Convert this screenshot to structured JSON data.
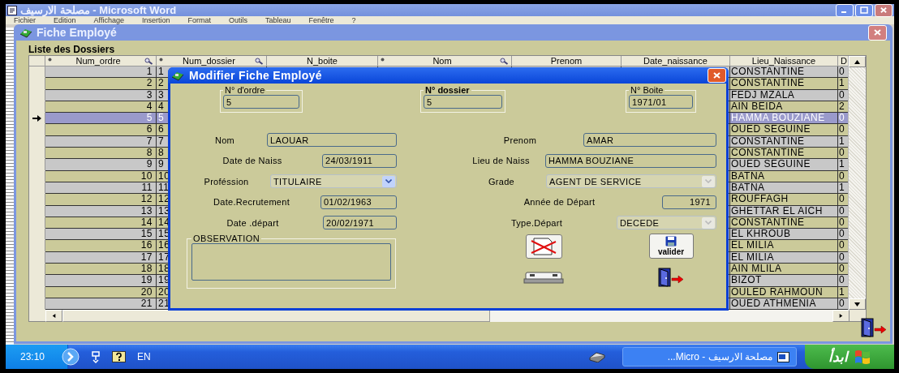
{
  "word_window": {
    "title": "مصلحة الارسيف - Microsoft Word",
    "menu": [
      "Fichier",
      "Edition",
      "Affichage",
      "Insertion",
      "Format",
      "Outils",
      "Tableau",
      "Fenêtre",
      "?"
    ]
  },
  "fiche_window": {
    "title": "Fiche Employé",
    "list_title": "Liste des Dossiers",
    "table": {
      "columns": [
        {
          "label": "Num_ordre",
          "indexed": true,
          "searchable": true
        },
        {
          "label": "Num_dossier",
          "indexed": true,
          "searchable": true
        },
        {
          "label": "N_boite",
          "indexed": false,
          "searchable": false
        },
        {
          "label": "Nom",
          "indexed": true,
          "searchable": true
        },
        {
          "label": "Prenom",
          "indexed": false,
          "searchable": false
        },
        {
          "label": "Date_naissance",
          "indexed": false,
          "searchable": false
        },
        {
          "label": "Lieu_Naissance",
          "indexed": false,
          "searchable": false
        },
        {
          "label": "D",
          "indexed": false,
          "searchable": false
        }
      ],
      "rows": [
        {
          "num_ordre": "1",
          "num_dossier": "1",
          "lieu_naissance": "CONSTANTINE",
          "column_9": "0",
          "selected": false
        },
        {
          "num_ordre": "2",
          "num_dossier": "2",
          "lieu_naissance": "CONSTANTINE",
          "column_9": "1",
          "selected": false
        },
        {
          "num_ordre": "3",
          "num_dossier": "3",
          "lieu_naissance": "FEDJ MZALA",
          "column_9": "0",
          "selected": false
        },
        {
          "num_ordre": "4",
          "num_dossier": "4",
          "lieu_naissance": "AIN BEIDA",
          "column_9": "2",
          "selected": false
        },
        {
          "num_ordre": "5",
          "num_dossier": "5",
          "lieu_naissance": "HAMMA BOUZIANE",
          "column_9": "0",
          "selected": true
        },
        {
          "num_ordre": "6",
          "num_dossier": "6",
          "lieu_naissance": "OUED SEGUINE",
          "column_9": "0",
          "selected": false
        },
        {
          "num_ordre": "7",
          "num_dossier": "7",
          "lieu_naissance": "CONSTANTINE",
          "column_9": "1",
          "selected": false
        },
        {
          "num_ordre": "8",
          "num_dossier": "8",
          "lieu_naissance": "CONSTANTINE",
          "column_9": "0",
          "selected": false
        },
        {
          "num_ordre": "9",
          "num_dossier": "9",
          "lieu_naissance": "OUED SEGUINE",
          "column_9": "1",
          "selected": false
        },
        {
          "num_ordre": "10",
          "num_dossier": "10",
          "lieu_naissance": "BATNA",
          "column_9": "0",
          "selected": false
        },
        {
          "num_ordre": "11",
          "num_dossier": "11",
          "lieu_naissance": "BATNA",
          "column_9": "1",
          "selected": false
        },
        {
          "num_ordre": "12",
          "num_dossier": "12",
          "lieu_naissance": "ROUFFAGH",
          "column_9": "0",
          "selected": false
        },
        {
          "num_ordre": "13",
          "num_dossier": "13",
          "lieu_naissance": "GHETTAR EL AICH",
          "column_9": "0",
          "selected": false
        },
        {
          "num_ordre": "14",
          "num_dossier": "14",
          "lieu_naissance": "CONSTANTINE",
          "column_9": "0",
          "selected": false
        },
        {
          "num_ordre": "15",
          "num_dossier": "15",
          "lieu_naissance": "EL KHROUB",
          "column_9": "0",
          "selected": false
        },
        {
          "num_ordre": "16",
          "num_dossier": "16",
          "lieu_naissance": "EL MILIA",
          "column_9": "0",
          "selected": false
        },
        {
          "num_ordre": "17",
          "num_dossier": "17",
          "lieu_naissance": "EL MILIA",
          "column_9": "0",
          "selected": false
        },
        {
          "num_ordre": "18",
          "num_dossier": "18",
          "lieu_naissance": "AIN MLILA",
          "column_9": "0",
          "selected": false
        },
        {
          "num_ordre": "19",
          "num_dossier": "19",
          "lieu_naissance": "BIZOT",
          "column_9": "0",
          "selected": false
        },
        {
          "num_ordre": "20",
          "num_dossier": "20",
          "lieu_naissance": "OULED RAHMOUN",
          "column_9": "1",
          "selected": false
        },
        {
          "num_ordre": "21",
          "num_dossier": "21",
          "lieu_naissance": "OUED ATHMENIA",
          "column_9": "0",
          "selected": false
        }
      ]
    }
  },
  "dialog": {
    "title": "Modifier Fiche Employé",
    "id_boxes": [
      {
        "label": "N° d'ordre",
        "value": "5",
        "bold": false
      },
      {
        "label": "N° dossier",
        "value": "5",
        "bold": true
      },
      {
        "label": "N° Boite",
        "value": "1971/01",
        "bold": false
      }
    ],
    "fields": [
      {
        "label": "Nom",
        "value": "LAOUAR",
        "kind": "text"
      },
      {
        "label": "Prenom",
        "value": "AMAR",
        "kind": "text"
      },
      {
        "label": "Date de Naiss",
        "value": "24/03/1911",
        "kind": "text"
      },
      {
        "label": "Lieu de Naiss",
        "value": "HAMMA BOUZIANE",
        "kind": "text"
      },
      {
        "label": "Proféssion",
        "value": "TITULAIRE",
        "kind": "combo",
        "disabled": false
      },
      {
        "label": "Grade",
        "value": "AGENT DE SERVICE",
        "kind": "combo",
        "disabled": true
      },
      {
        "label": "Date.Recrutement",
        "value": "01/02/1963",
        "kind": "text"
      },
      {
        "label": "Année de Départ",
        "value": "1971",
        "kind": "number"
      },
      {
        "label": "Date .départ",
        "value": "20/02/1971",
        "kind": "text"
      },
      {
        "label": "Type.Départ",
        "value": "DECEDE",
        "kind": "combo",
        "disabled": true
      }
    ],
    "observation": {
      "label": "OBSERVATION"
    },
    "actions": [
      {
        "kind": "delete"
      },
      {
        "kind": "save",
        "label": "valider"
      },
      {
        "kind": "print"
      },
      {
        "kind": "exit"
      }
    ]
  },
  "taskbar": {
    "clock": "23:10",
    "language": "EN",
    "tasks": [
      {
        "label": "مصلحة الارسيف - Micro...",
        "selected": false
      }
    ],
    "start": "ابدأ"
  }
}
